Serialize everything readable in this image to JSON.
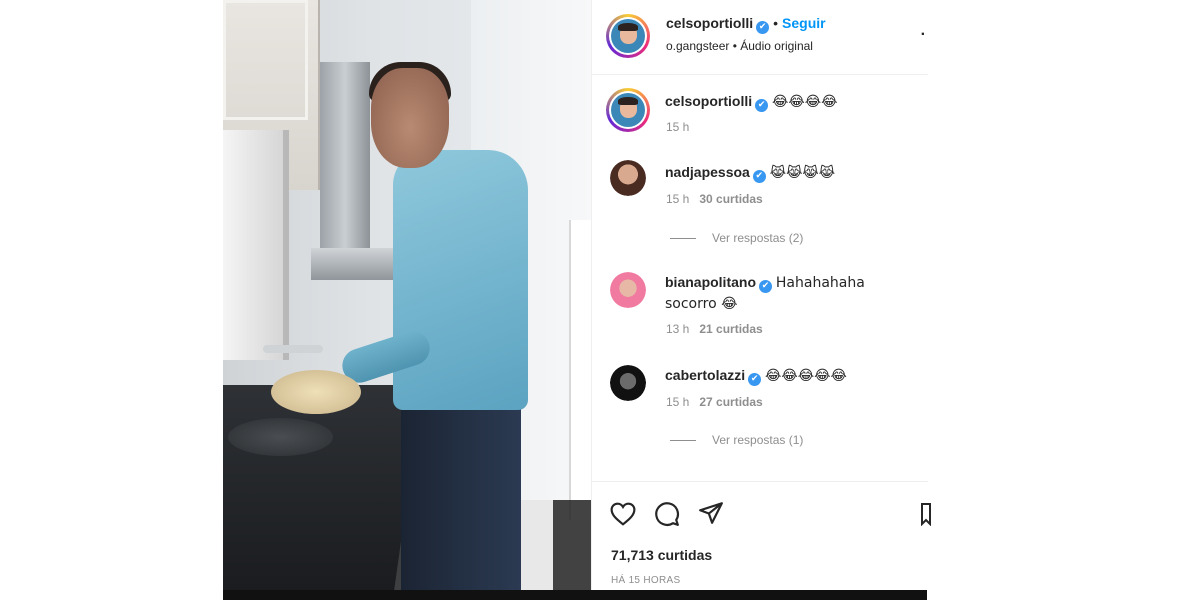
{
  "post": {
    "username": "celsoportiolli",
    "follow_label": "Seguir",
    "separator": "•",
    "subtitle": "o.gangsteer • Áudio original",
    "verified_icon": "✔",
    "more_icon": "·"
  },
  "comments": [
    {
      "user": "celsoportiolli",
      "text": "😂😂😂😂",
      "time": "15 h",
      "likes": ""
    },
    {
      "user": "nadjapessoa",
      "text": "😹😹😹😹",
      "time": "15 h",
      "likes": "30 curtidas",
      "replies": "Ver respostas (2)"
    },
    {
      "user": "bianapolitano",
      "text": "Hahahahaha socorro 😂",
      "time": "13 h",
      "likes": "21 curtidas"
    },
    {
      "user": "cabertolazzi",
      "text": "😂😂😂😂😂",
      "time": "15 h",
      "likes": "27 curtidas",
      "replies": "Ver respostas (1)"
    }
  ],
  "footer": {
    "likes": "71,713 curtidas",
    "time": "HÁ 15 HORAS"
  },
  "icons": [
    "heart-icon",
    "comment-icon",
    "share-icon",
    "bookmark-icon"
  ],
  "colors": {
    "accent": "#0095f6",
    "verified": "#3897f0",
    "muted": "#8e8e8e",
    "text": "#262626"
  }
}
